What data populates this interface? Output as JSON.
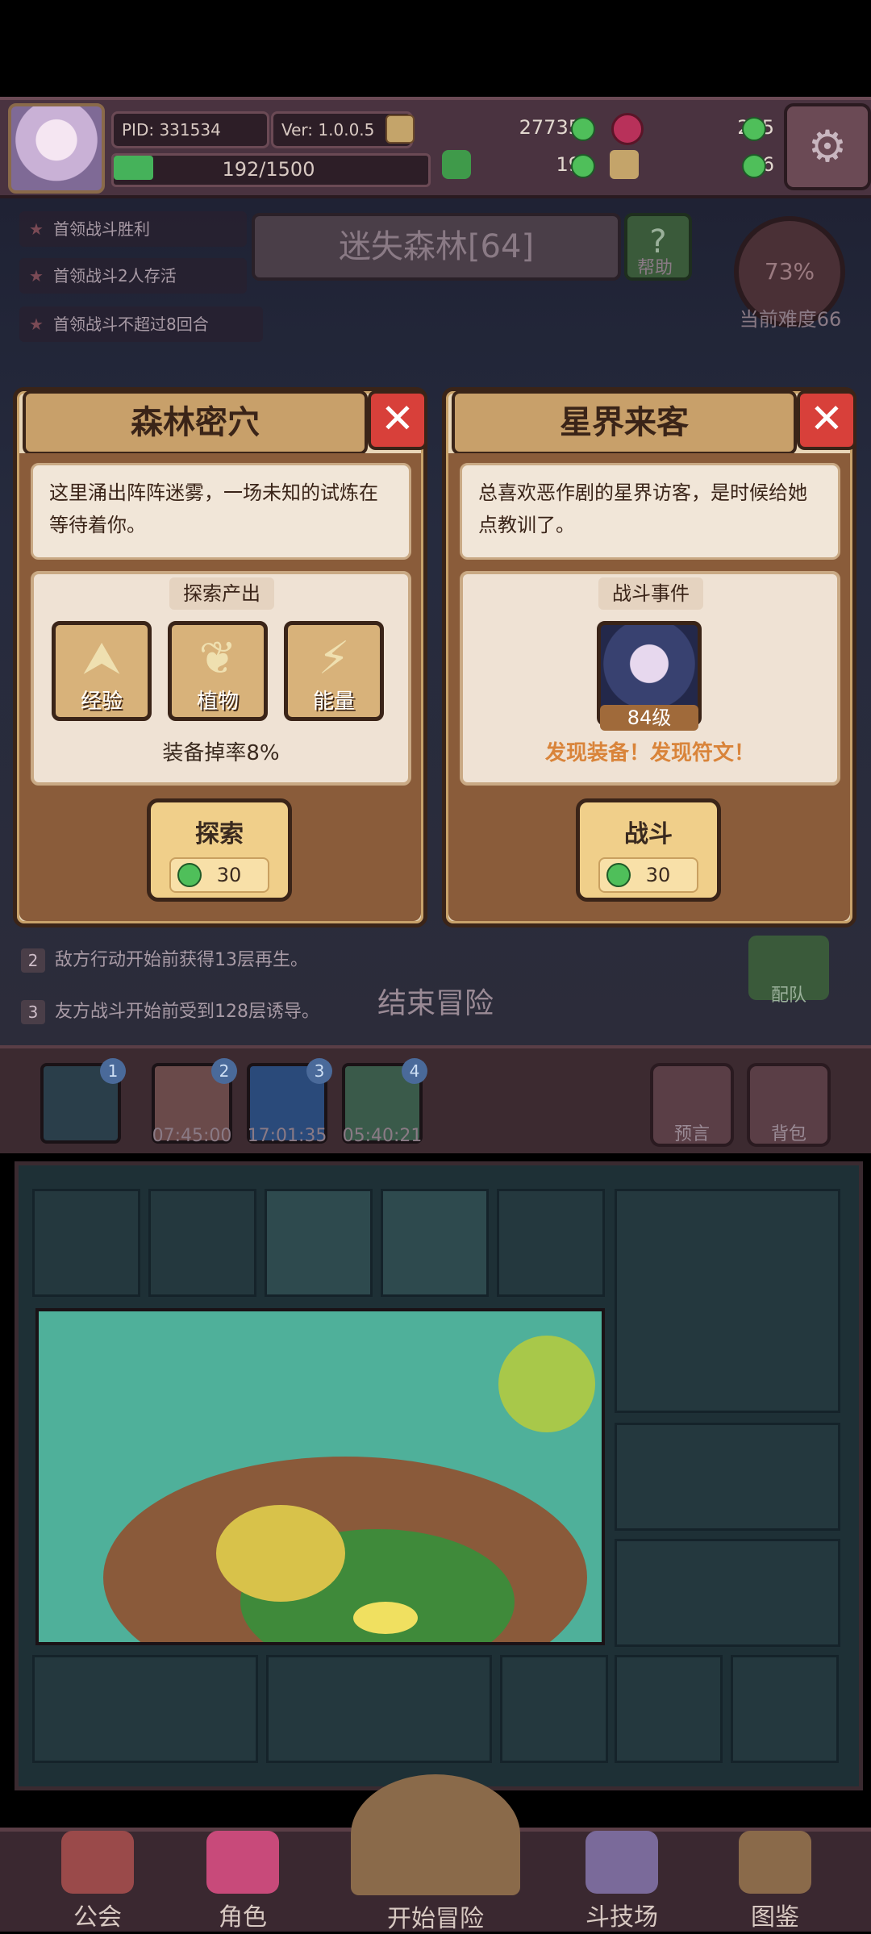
{
  "header": {
    "pid": "PID: 331534",
    "version": "Ver: 1.0.0.5",
    "gold": "27735",
    "ruby": "225",
    "clover": "19",
    "key": "6",
    "xp": "192/1500",
    "xp_fraction": 0.128
  },
  "quests": [
    "首领战斗胜利",
    "首领战斗2人存活",
    "首领战斗不超过8回合"
  ],
  "zone": {
    "title": "迷失森林[64]",
    "help_label": "帮助",
    "difficulty_percent": "73%",
    "difficulty_label": "当前难度66"
  },
  "card_left": {
    "title": "森林密穴",
    "description": "这里涌出阵阵迷雾，一场未知的试炼在等待着你。",
    "panel_title": "探索产出",
    "yields": [
      {
        "icon": "exp-up-icon",
        "glyph": "⮝",
        "label": "经验"
      },
      {
        "icon": "leaf-icon",
        "glyph": "❦",
        "label": "植物"
      },
      {
        "icon": "lightning-icon",
        "glyph": "⚡",
        "label": "能量"
      }
    ],
    "drop_rate": "装备掉率8%",
    "action_label": "探索",
    "action_cost": "30"
  },
  "card_right": {
    "title": "星界来客",
    "description": "总喜欢恶作剧的星界访客，是时候给她点教训了。",
    "panel_title": "战斗事件",
    "boss_level": "84级",
    "reward_text": "发现装备！发现符文！",
    "action_label": "战斗",
    "action_cost": "30"
  },
  "rules": [
    {
      "num": "2",
      "text": "敌方行动开始前获得13层再生。"
    },
    {
      "num": "3",
      "text": "友方战斗开始前受到128层诱导。"
    }
  ],
  "end_adventure": "结束冒险",
  "team_label": "配队",
  "stages": [
    {
      "num": "1",
      "timer": ""
    },
    {
      "num": "2",
      "timer": "07:45:00"
    },
    {
      "num": "3",
      "timer": "17:01:35"
    },
    {
      "num": "4",
      "timer": "05:40:21"
    }
  ],
  "side_buttons": {
    "prophecy": "预言",
    "bag": "背包"
  },
  "nav": {
    "guild": "公会",
    "character": "角色",
    "adventure": "开始冒险",
    "arena": "斗技场",
    "codex": "图鉴"
  },
  "colors": {
    "gem_green": "#4fbf5a",
    "close_red": "#d8403a",
    "reward_orange": "#d9843a",
    "card_bg": "#e8d6b8"
  },
  "close_icon": "close-icon"
}
